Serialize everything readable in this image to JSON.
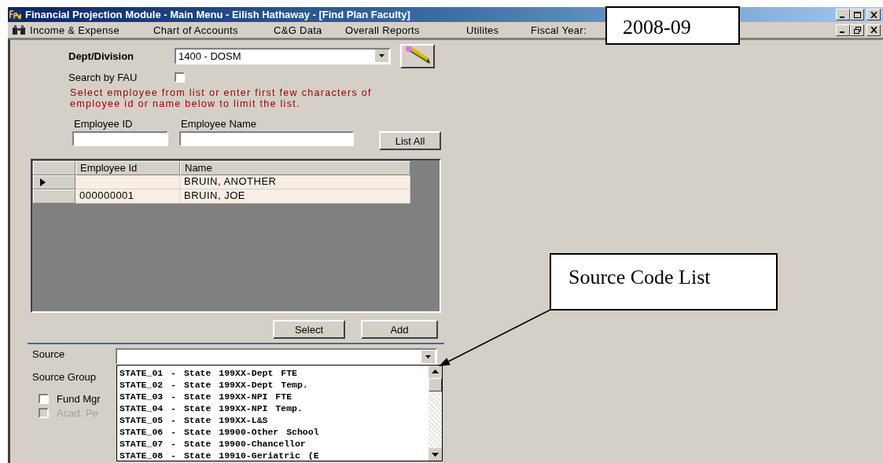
{
  "window": {
    "title": "Financial Projection Module - Main Menu - Eilish Hathaway - [Find Plan Faculty]"
  },
  "menu": [
    {
      "label": "Income & Expense"
    },
    {
      "label": "Chart of Accounts"
    },
    {
      "label": "C&G Data"
    },
    {
      "label": "Overall Reports"
    },
    {
      "label": "Utilites"
    },
    {
      "label": "Fiscal Year:"
    }
  ],
  "dept": {
    "label": "Dept/Division",
    "value": "1400 - DOSM"
  },
  "search_by_fau": {
    "label": "Search by FAU",
    "checked": false
  },
  "instructions": "Select employee from list or enter first few characters of employee id or name below to limit the list.",
  "employee_id": {
    "label": "Employee ID"
  },
  "employee_name": {
    "label": "Employee Name"
  },
  "list_all_button": "List All",
  "grid": {
    "columns": [
      "Employee Id",
      "Name"
    ],
    "rows": [
      {
        "id": "",
        "name": "BRUIN, ANOTHER",
        "selected": true
      },
      {
        "id": "000000001",
        "name": "BRUIN, JOE",
        "selected": false
      }
    ]
  },
  "buttons": [
    "Select",
    "Add"
  ],
  "source": {
    "label": "Source"
  },
  "source_group": {
    "label": "Source Group"
  },
  "options": [
    {
      "label": "Fund Mgr",
      "checked": false,
      "disabled": false
    },
    {
      "label": "Acad. Pe",
      "checked": false,
      "disabled": true
    }
  ],
  "source_list": [
    "STATE_01 - State 199XX-Dept FTE",
    "STATE_02 - State 199XX-Dept Temp.",
    "STATE_03 - State 199XX-NPI FTE",
    "STATE_04 - State 199XX-NPI Temp.",
    "STATE_05 - State 199XX-L&S",
    "STATE_06 - State 19900-Other School",
    "STATE_07 - State 19900-Chancellor",
    "STATE_08 - State 19910-Geriatric (E"
  ],
  "callouts": [
    {
      "kind": "fiscal",
      "text": "2008-09"
    },
    {
      "kind": "source",
      "text": "Source Code List"
    }
  ]
}
